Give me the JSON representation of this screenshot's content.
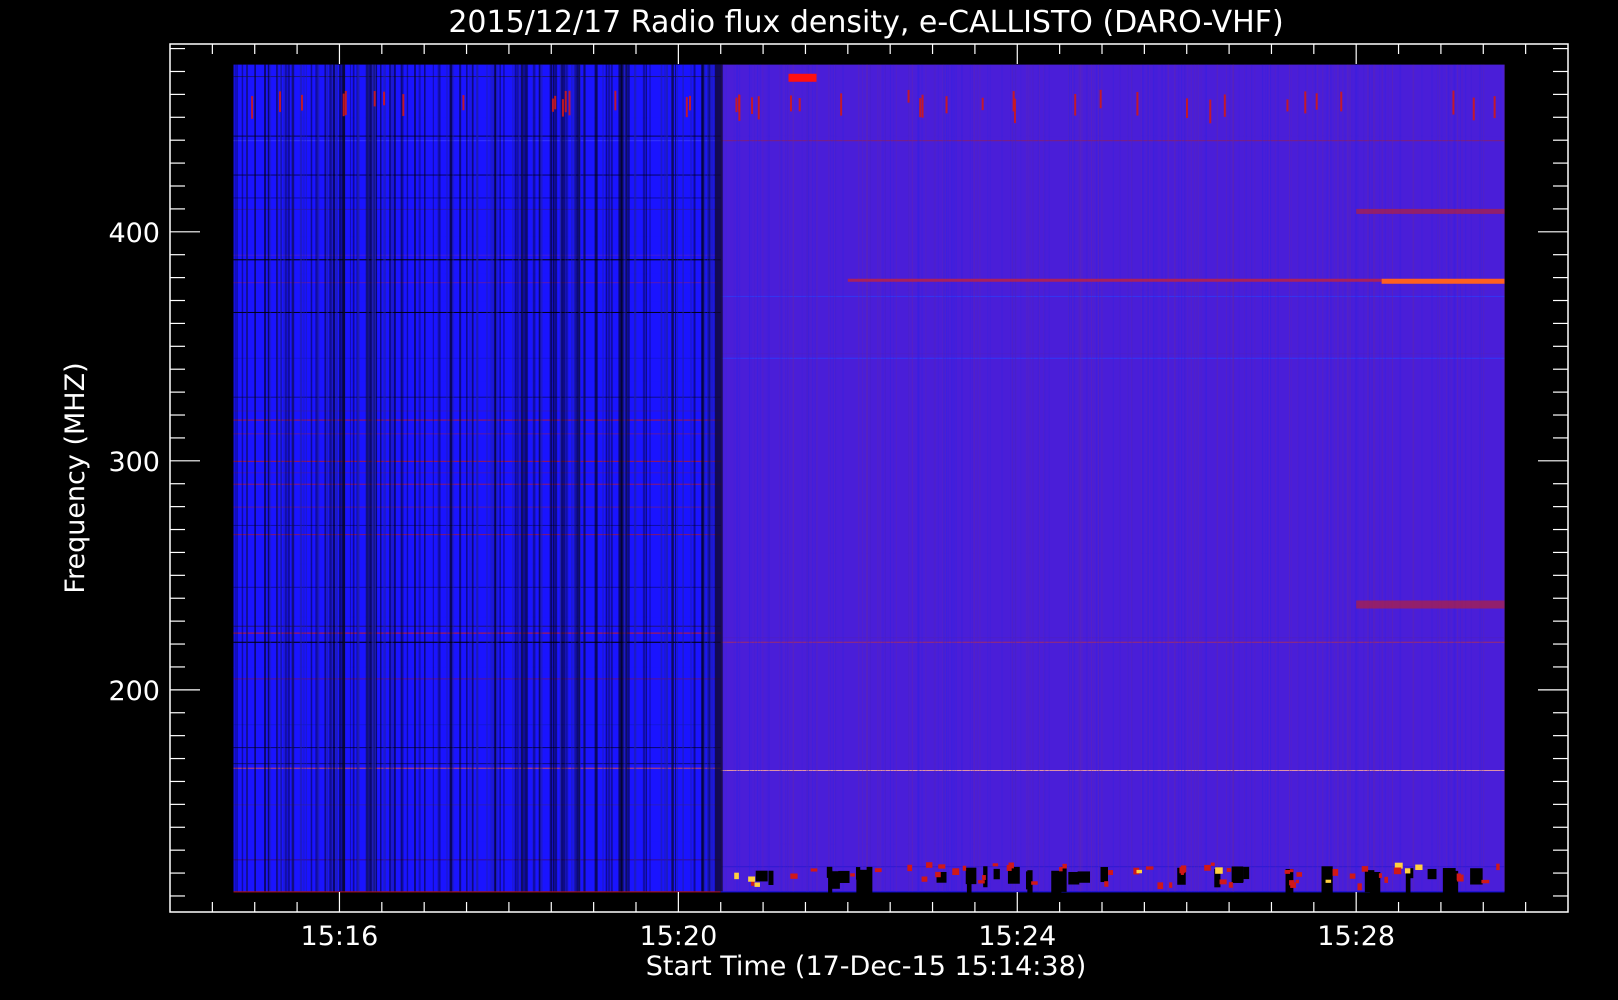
{
  "chart_data": {
    "type": "heatmap",
    "title": "2015/12/17  Radio flux density, e-CALLISTO (DARO-VHF)",
    "xlabel": "Start Time (17-Dec-15 15:14:38)",
    "ylabel": "Frequency (MHZ)",
    "x_ticks": [
      "15:16",
      "15:20",
      "15:24",
      "15:28"
    ],
    "y_ticks": [
      "200",
      "300",
      "400"
    ],
    "xlim_minutes_after_1500": [
      14.0,
      30.5
    ],
    "ylim_mhz": [
      482,
      103
    ],
    "data_time_range_minutes_after_1500": [
      14.75,
      29.75
    ],
    "data_freq_range_mhz": [
      112,
      473
    ],
    "transition_time_minutes_after_1500": 20.5,
    "colors": {
      "background": "#000000",
      "low": "#1a14ff",
      "mid": "#5a20c8",
      "high": "#d01818",
      "peak": "#ffd040"
    },
    "grid": false,
    "legend": "none"
  }
}
